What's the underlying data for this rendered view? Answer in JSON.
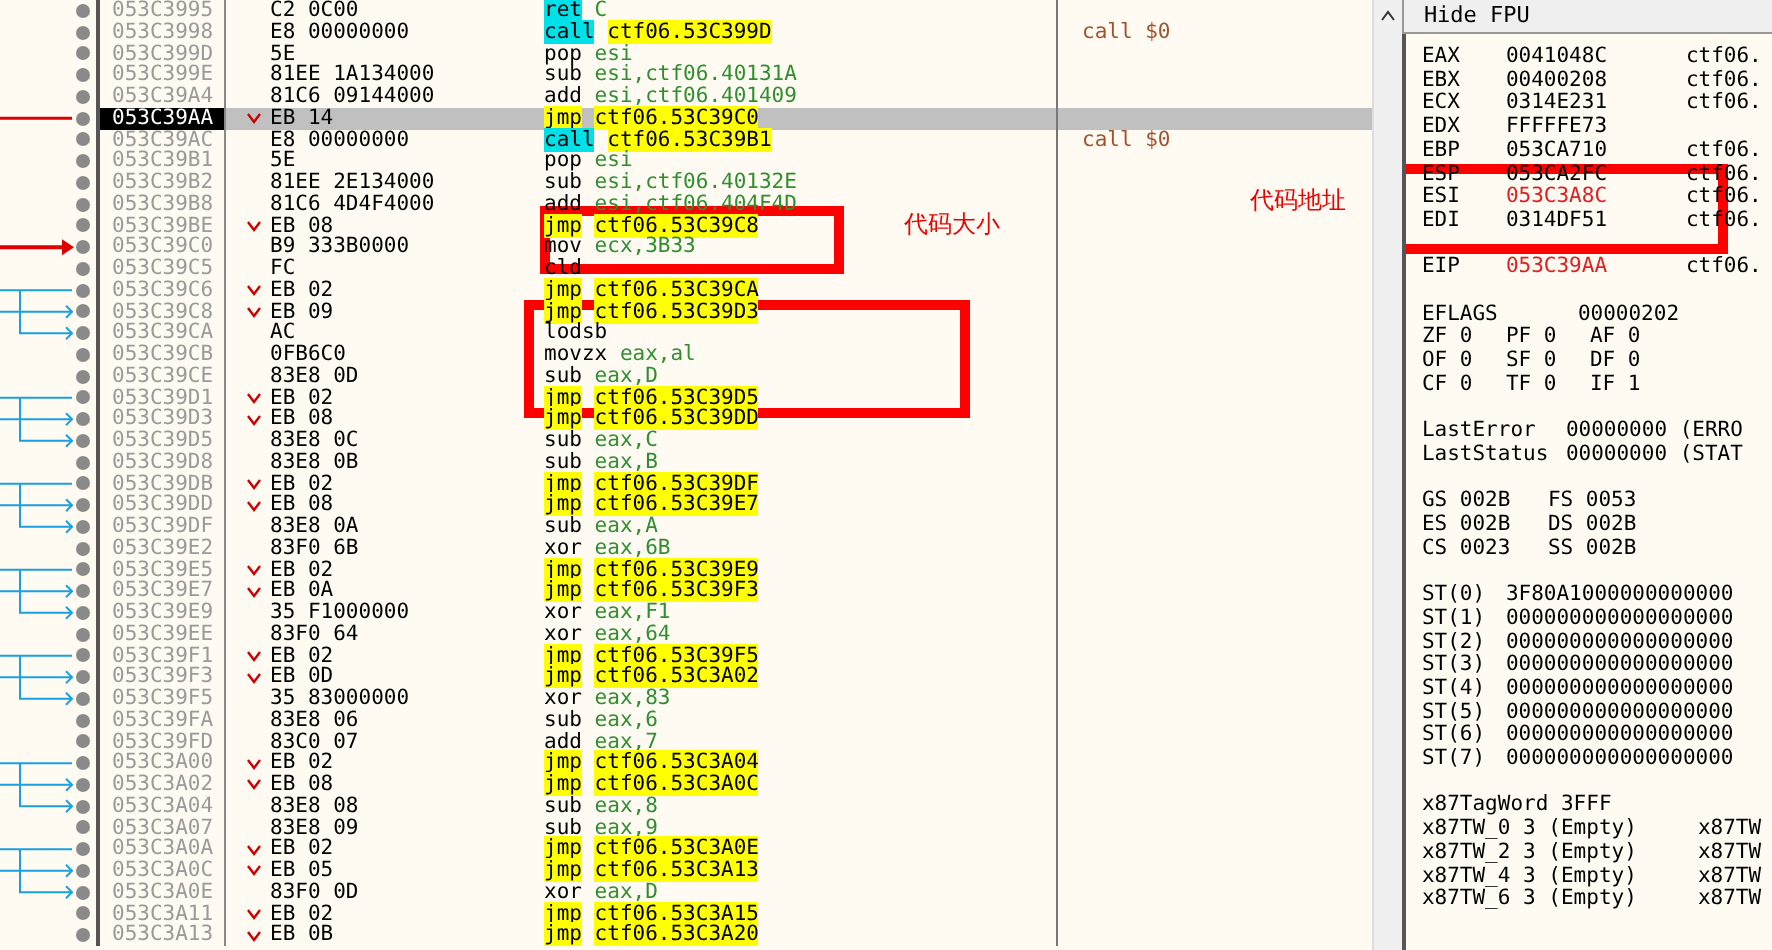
{
  "disassembly": {
    "rows": [
      {
        "address": "053C3995",
        "bytes": "C2 0C00",
        "mnemonic": "ret",
        "operand": "C",
        "kind": "ret",
        "selected": false
      },
      {
        "address": "053C3998",
        "bytes": "E8 00000000",
        "mnemonic": "call",
        "operand": "ctf06.53C399D",
        "kind": "call",
        "comment": "call $0",
        "selected": false
      },
      {
        "address": "053C399D",
        "bytes": "5E",
        "mnemonic": "pop",
        "operand": "esi",
        "kind": "plain",
        "selected": false
      },
      {
        "address": "053C399E",
        "bytes": "81EE 1A134000",
        "mnemonic": "sub",
        "operand": "esi,ctf06.40131A",
        "kind": "plain",
        "selected": false
      },
      {
        "address": "053C39A4",
        "bytes": "81C6 09144000",
        "mnemonic": "add",
        "operand": "esi,ctf06.401409",
        "kind": "plain",
        "selected": false
      },
      {
        "address": "053C39AA",
        "bytes": "EB 14",
        "mnemonic": "jmp",
        "operand": "ctf06.53C39C0",
        "kind": "jump",
        "selected": true
      },
      {
        "address": "053C39AC",
        "bytes": "E8 00000000",
        "mnemonic": "call",
        "operand": "ctf06.53C39B1",
        "kind": "call",
        "comment": "call $0",
        "selected": false
      },
      {
        "address": "053C39B1",
        "bytes": "5E",
        "mnemonic": "pop",
        "operand": "esi",
        "kind": "plain",
        "selected": false
      },
      {
        "address": "053C39B2",
        "bytes": "81EE 2E134000",
        "mnemonic": "sub",
        "operand": "esi,ctf06.40132E",
        "kind": "plain",
        "selected": false
      },
      {
        "address": "053C39B8",
        "bytes": "81C6 4D4F4000",
        "mnemonic": "add",
        "operand": "esi,ctf06.404F4D",
        "kind": "plain",
        "selected": false
      },
      {
        "address": "053C39BE",
        "bytes": "EB 08",
        "mnemonic": "jmp",
        "operand": "ctf06.53C39C8",
        "kind": "jump",
        "selected": false
      },
      {
        "address": "053C39C0",
        "bytes": "B9 333B0000",
        "mnemonic": "mov",
        "operand": "ecx,3B33",
        "kind": "plain",
        "selected": false
      },
      {
        "address": "053C39C5",
        "bytes": "FC",
        "mnemonic": "cld",
        "operand": "",
        "kind": "plain",
        "selected": false
      },
      {
        "address": "053C39C6",
        "bytes": "EB 02",
        "mnemonic": "jmp",
        "operand": "ctf06.53C39CA",
        "kind": "jump",
        "selected": false
      },
      {
        "address": "053C39C8",
        "bytes": "EB 09",
        "mnemonic": "jmp",
        "operand": "ctf06.53C39D3",
        "kind": "jump",
        "selected": false
      },
      {
        "address": "053C39CA",
        "bytes": "AC",
        "mnemonic": "lodsb",
        "operand": "",
        "kind": "plain",
        "selected": false
      },
      {
        "address": "053C39CB",
        "bytes": "0FB6C0",
        "mnemonic": "movzx",
        "operand": "eax,al",
        "kind": "plain",
        "selected": false
      },
      {
        "address": "053C39CE",
        "bytes": "83E8 0D",
        "mnemonic": "sub",
        "operand": "eax,D",
        "kind": "plain",
        "selected": false
      },
      {
        "address": "053C39D1",
        "bytes": "EB 02",
        "mnemonic": "jmp",
        "operand": "ctf06.53C39D5",
        "kind": "jump",
        "selected": false
      },
      {
        "address": "053C39D3",
        "bytes": "EB 08",
        "mnemonic": "jmp",
        "operand": "ctf06.53C39DD",
        "kind": "jump",
        "selected": false
      },
      {
        "address": "053C39D5",
        "bytes": "83E8 0C",
        "mnemonic": "sub",
        "operand": "eax,C",
        "kind": "plain",
        "selected": false
      },
      {
        "address": "053C39D8",
        "bytes": "83E8 0B",
        "mnemonic": "sub",
        "operand": "eax,B",
        "kind": "plain",
        "selected": false
      },
      {
        "address": "053C39DB",
        "bytes": "EB 02",
        "mnemonic": "jmp",
        "operand": "ctf06.53C39DF",
        "kind": "jump",
        "selected": false
      },
      {
        "address": "053C39DD",
        "bytes": "EB 08",
        "mnemonic": "jmp",
        "operand": "ctf06.53C39E7",
        "kind": "jump",
        "selected": false
      },
      {
        "address": "053C39DF",
        "bytes": "83E8 0A",
        "mnemonic": "sub",
        "operand": "eax,A",
        "kind": "plain",
        "selected": false
      },
      {
        "address": "053C39E2",
        "bytes": "83F0 6B",
        "mnemonic": "xor",
        "operand": "eax,6B",
        "kind": "plain",
        "selected": false
      },
      {
        "address": "053C39E5",
        "bytes": "EB 02",
        "mnemonic": "jmp",
        "operand": "ctf06.53C39E9",
        "kind": "jump",
        "selected": false
      },
      {
        "address": "053C39E7",
        "bytes": "EB 0A",
        "mnemonic": "jmp",
        "operand": "ctf06.53C39F3",
        "kind": "jump",
        "selected": false
      },
      {
        "address": "053C39E9",
        "bytes": "35 F1000000",
        "mnemonic": "xor",
        "operand": "eax,F1",
        "kind": "plain",
        "selected": false
      },
      {
        "address": "053C39EE",
        "bytes": "83F0 64",
        "mnemonic": "xor",
        "operand": "eax,64",
        "kind": "plain",
        "selected": false
      },
      {
        "address": "053C39F1",
        "bytes": "EB 02",
        "mnemonic": "jmp",
        "operand": "ctf06.53C39F5",
        "kind": "jump",
        "selected": false
      },
      {
        "address": "053C39F3",
        "bytes": "EB 0D",
        "mnemonic": "jmp",
        "operand": "ctf06.53C3A02",
        "kind": "jump",
        "selected": false
      },
      {
        "address": "053C39F5",
        "bytes": "35 83000000",
        "mnemonic": "xor",
        "operand": "eax,83",
        "kind": "plain",
        "selected": false
      },
      {
        "address": "053C39FA",
        "bytes": "83E8 06",
        "mnemonic": "sub",
        "operand": "eax,6",
        "kind": "plain",
        "selected": false
      },
      {
        "address": "053C39FD",
        "bytes": "83C0 07",
        "mnemonic": "add",
        "operand": "eax,7",
        "kind": "plain",
        "selected": false
      },
      {
        "address": "053C3A00",
        "bytes": "EB 02",
        "mnemonic": "jmp",
        "operand": "ctf06.53C3A04",
        "kind": "jump",
        "selected": false
      },
      {
        "address": "053C3A02",
        "bytes": "EB 08",
        "mnemonic": "jmp",
        "operand": "ctf06.53C3A0C",
        "kind": "jump",
        "selected": false
      },
      {
        "address": "053C3A04",
        "bytes": "83E8 08",
        "mnemonic": "sub",
        "operand": "eax,8",
        "kind": "plain",
        "selected": false
      },
      {
        "address": "053C3A07",
        "bytes": "83E8 09",
        "mnemonic": "sub",
        "operand": "eax,9",
        "kind": "plain",
        "selected": false
      },
      {
        "address": "053C3A0A",
        "bytes": "EB 02",
        "mnemonic": "jmp",
        "operand": "ctf06.53C3A0E",
        "kind": "jump",
        "selected": false
      },
      {
        "address": "053C3A0C",
        "bytes": "EB 05",
        "mnemonic": "jmp",
        "operand": "ctf06.53C3A13",
        "kind": "jump",
        "selected": false
      },
      {
        "address": "053C3A0E",
        "bytes": "83F0 0D",
        "mnemonic": "xor",
        "operand": "eax,D",
        "kind": "plain",
        "selected": false
      },
      {
        "address": "053C3A11",
        "bytes": "EB 02",
        "mnemonic": "jmp",
        "operand": "ctf06.53C3A15",
        "kind": "jump",
        "selected": false
      },
      {
        "address": "053C3A13",
        "bytes": "EB 0B",
        "mnemonic": "jmp",
        "operand": "ctf06.53C3A20",
        "kind": "jump",
        "selected": false
      }
    ]
  },
  "annotations": [
    {
      "text": "代码大小"
    },
    {
      "text": "代码地址"
    }
  ],
  "registers": {
    "toggle": "Hide FPU",
    "general": [
      {
        "name": "EAX",
        "value": "0041048C",
        "comment": "ctf06.",
        "changed": false
      },
      {
        "name": "EBX",
        "value": "00400208",
        "comment": "ctf06.",
        "changed": false
      },
      {
        "name": "ECX",
        "value": "0314E231",
        "comment": "ctf06.",
        "changed": false
      },
      {
        "name": "EDX",
        "value": "FFFFFE73",
        "changed": false
      },
      {
        "name": "EBP",
        "value": "053CA710",
        "comment": "ctf06.",
        "changed": false
      },
      {
        "name": "ESP",
        "value": "053CA2FC",
        "comment": "ctf06.",
        "changed": false
      },
      {
        "name": "ESI",
        "value": "053C3A8C",
        "comment": "ctf06.",
        "changed": true
      },
      {
        "name": "EDI",
        "value": "0314DF51",
        "comment": "ctf06.",
        "changed": false
      }
    ],
    "eip": {
      "name": "EIP",
      "value": "053C39AA",
      "comment": "ctf06.",
      "changed": true
    },
    "eflags": {
      "name": "EFLAGS",
      "value": "00000202"
    },
    "flags": [
      [
        "ZF 0",
        "PF 0",
        "AF 0"
      ],
      [
        "OF 0",
        "SF 0",
        "DF 0"
      ],
      [
        "CF 0",
        "TF 0",
        "IF 1"
      ]
    ],
    "last": [
      {
        "name": "LastError",
        "value": "00000000 (ERRO"
      },
      {
        "name": "LastStatus",
        "value": "00000000 (STAT"
      }
    ],
    "segments": [
      [
        "GS 002B",
        "FS 0053"
      ],
      [
        "ES 002B",
        "DS 002B"
      ],
      [
        "CS 0023",
        "SS 002B"
      ]
    ],
    "fpu": [
      {
        "name": "ST(0)",
        "value": "3F80A1000000000000"
      },
      {
        "name": "ST(1)",
        "value": "000000000000000000"
      },
      {
        "name": "ST(2)",
        "value": "000000000000000000"
      },
      {
        "name": "ST(3)",
        "value": "000000000000000000"
      },
      {
        "name": "ST(4)",
        "value": "000000000000000000"
      },
      {
        "name": "ST(5)",
        "value": "000000000000000000"
      },
      {
        "name": "ST(6)",
        "value": "000000000000000000"
      },
      {
        "name": "ST(7)",
        "value": "000000000000000000"
      }
    ],
    "tag_word": "x87TagWord 3FFF",
    "tag_rows": [
      [
        "x87TW_0 3 (Empty)",
        "x87TW"
      ],
      [
        "x87TW_2 3 (Empty)",
        "x87TW"
      ],
      [
        "x87TW_4 3 (Empty)",
        "x87TW"
      ],
      [
        "x87TW_6 3 (Empty)",
        "x87TW"
      ]
    ]
  }
}
